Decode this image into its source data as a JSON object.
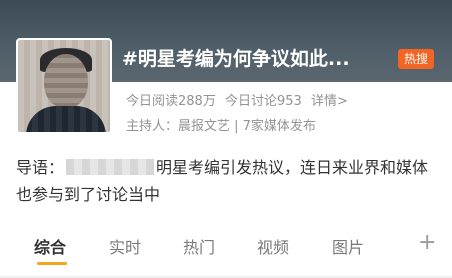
{
  "topic": {
    "title": "#明星考编为何争议如此...",
    "badge": "热搜"
  },
  "stats": {
    "reads": "今日阅读288万",
    "discussions": "今日讨论953",
    "detail": "详情>"
  },
  "host": "主持人：晨报文艺 | 7家媒体发布",
  "guide": {
    "prefix": "导语：",
    "text": "明星考编引发热议，连日来业界和媒体也参与到了讨论当中"
  },
  "tabs": [
    {
      "label": "综合"
    },
    {
      "label": "实时"
    },
    {
      "label": "热门"
    },
    {
      "label": "视频"
    },
    {
      "label": "图片"
    }
  ],
  "add_icon": "plus-icon",
  "colors": {
    "badge": "#f26522",
    "active_underline": "#f7a51c"
  }
}
